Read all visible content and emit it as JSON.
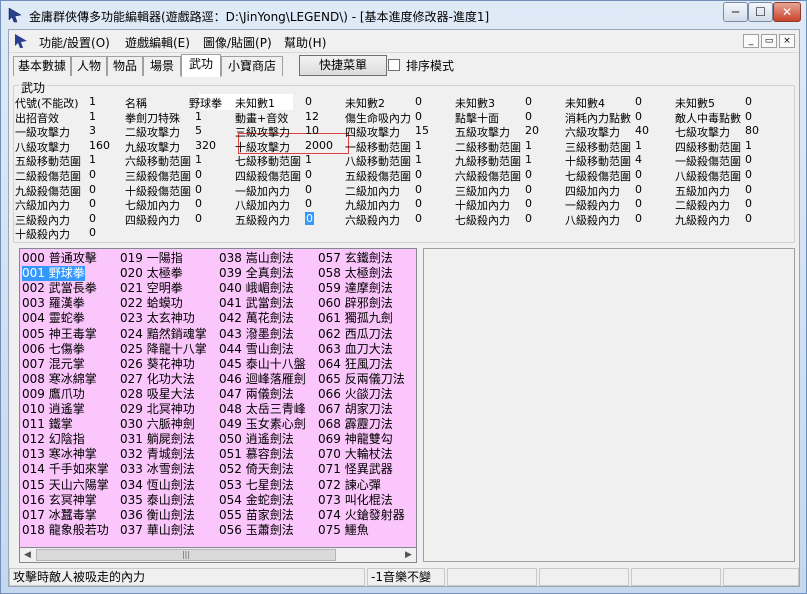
{
  "window": {
    "title": "金庸群俠傳多功能編輯器(遊戲路逕：D:\\JinYong\\LEGEND\\) - [基本進度修改器-進度1]",
    "min_symbol": "─",
    "max_symbol": "☐",
    "close_symbol": "✕"
  },
  "menu": {
    "items": [
      "功能/設置(O)",
      "遊戲編輯(E)",
      "圖像/貼圖(P)",
      "幫助(H)"
    ],
    "mdi_min": "_",
    "mdi_restore": "▭",
    "mdi_close": "×"
  },
  "tabs": [
    "基本數據",
    "人物",
    "物品",
    "場景",
    "武功",
    "小寶商店"
  ],
  "toolbar": {
    "quick_menu": "快捷菜單",
    "sort_mode": "排序模式"
  },
  "group_title": "武功",
  "fields": [
    [
      "代號(不能改)",
      "1",
      "名稱",
      "野球拳",
      "未知數1",
      "0",
      "未知數2",
      "0",
      "未知數3",
      "0",
      "未知數4",
      "0",
      "未知數5",
      "0"
    ],
    [
      "出招音效",
      "1",
      "拳劍刀特殊",
      "1",
      "動畫+音效",
      "12",
      "傷生命吸內力",
      "0",
      "點擊十面",
      "0",
      "消耗內力點數",
      "0",
      "敵人中毒點數",
      "0"
    ],
    [
      "一級攻擊力",
      "3",
      "二級攻擊力",
      "5",
      "三級攻擊力",
      "10",
      "四級攻擊力",
      "15",
      "五級攻擊力",
      "20",
      "六級攻擊力",
      "40",
      "七級攻擊力",
      "80"
    ],
    [
      "八級攻擊力",
      "160",
      "九級攻擊力",
      "320",
      "十級攻擊力",
      "2000",
      "一級移動范圍",
      "1",
      "二級移動范圍",
      "1",
      "三級移動范圍",
      "1",
      "四級移動范圍",
      "1"
    ],
    [
      "五級移動范圍",
      "1",
      "六級移動范圍",
      "1",
      "七級移動范圍",
      "1",
      "八級移動范圍",
      "1",
      "九級移動范圍",
      "1",
      "十級移動范圍",
      "4",
      "一級殺傷范圍",
      "0"
    ],
    [
      "二級殺傷范圍",
      "0",
      "三級殺傷范圍",
      "0",
      "四級殺傷范圍",
      "0",
      "五級殺傷范圍",
      "0",
      "六級殺傷范圍",
      "0",
      "七級殺傷范圍",
      "0",
      "八級殺傷范圍",
      "0"
    ],
    [
      "九級殺傷范圍",
      "0",
      "十級殺傷范圍",
      "0",
      "一級加內力",
      "0",
      "二級加內力",
      "0",
      "三級加內力",
      "0",
      "四級加內力",
      "0",
      "五級加內力",
      "0"
    ],
    [
      "六級加內力",
      "0",
      "七級加內力",
      "0",
      "八級加內力",
      "0",
      "九級加內力",
      "0",
      "十級加內力",
      "0",
      "一級殺內力",
      "0",
      "二級殺內力",
      "0"
    ],
    [
      "三級殺內力",
      "0",
      "四級殺內力",
      "0",
      "五級殺內力",
      "0",
      "六級殺內力",
      "0",
      "七級殺內力",
      "0",
      "八級殺內力",
      "0",
      "九級殺內力",
      "0"
    ],
    [
      "十級殺內力",
      "0"
    ]
  ],
  "list": {
    "selected": "001 野球拳",
    "columns": [
      [
        "000 普通攻擊",
        "001 野球拳",
        "002 武當長拳",
        "003 羅漢拳",
        "004 靈蛇拳",
        "005 神王毒掌",
        "006 七傷拳",
        "007 混元掌",
        "008 寒冰綿掌",
        "009 鷹爪功",
        "010 逍遙掌",
        "011 鐵掌",
        "012 幻陰指",
        "013 寒冰神掌",
        "014 千手如來掌",
        "015 天山六陽掌",
        "016 玄冥神掌",
        "017 冰蠶毒掌",
        "018 龍象般若功"
      ],
      [
        "019 一陽指",
        "020 太極拳",
        "021 空明拳",
        "022 蛤蟆功",
        "023 太玄神功",
        "024 黯然銷魂掌",
        "025 降龍十八掌",
        "026 葵花神功",
        "027 化功大法",
        "028 吸星大法",
        "029 北冥神功",
        "030 六脈神劍",
        "031 躺屍劍法",
        "032 青城劍法",
        "033 冰雪劍法",
        "034 恆山劍法",
        "035 泰山劍法",
        "036 衡山劍法",
        "037 華山劍法"
      ],
      [
        "038 嵩山劍法",
        "039 全真劍法",
        "040 峨嵋劍法",
        "041 武當劍法",
        "042 萬花劍法",
        "043 潑墨劍法",
        "044 雪山劍法",
        "045 泰山十八盤",
        "046 迴峰落雁劍",
        "047 兩儀劍法",
        "048 太岳三青峰",
        "049 玉女素心劍",
        "050 逍遙劍法",
        "051 慕容劍法",
        "052 倚天劍法",
        "053 七星劍法",
        "054 金蛇劍法",
        "055 苗家劍法",
        "056 玉蕭劍法"
      ],
      [
        "057 玄鐵劍法",
        "058 太極劍法",
        "059 達摩劍法",
        "060 辟邪劍法",
        "061 獨孤九劍",
        "062 西瓜刀法",
        "063 血刀大法",
        "064 狂風刀法",
        "065 反兩儀刀法",
        "066 火燄刀法",
        "067 胡家刀法",
        "068 霹靂刀法",
        "069 神龍雙勾",
        "070 大輪杖法",
        "071 怪異武器",
        "072 諫心彈",
        "073 叫化棍法",
        "074 火鎗發射器",
        "075 鱷魚"
      ]
    ]
  },
  "status": {
    "left": "攻擊時敵人被吸走的內力",
    "right": "-1音樂不變"
  },
  "colors": {
    "list_bg": "#fbc6fb",
    "selection": "#3399ff",
    "highlight_border": "#e04040"
  }
}
